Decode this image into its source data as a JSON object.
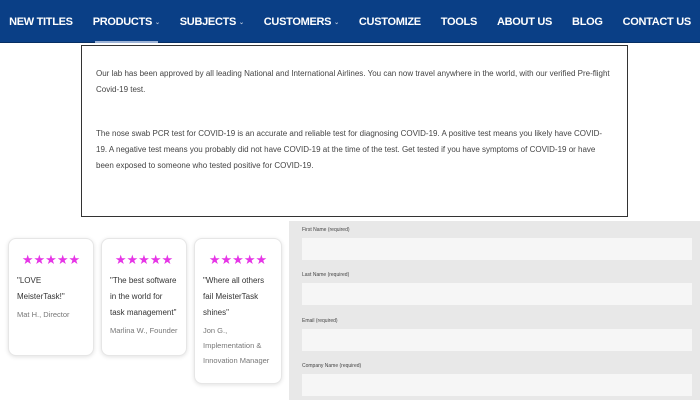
{
  "nav": {
    "items": [
      {
        "label": "NEW TITLES",
        "has_dropdown": false
      },
      {
        "label": "PRODUCTS",
        "has_dropdown": true
      },
      {
        "label": "SUBJECTS",
        "has_dropdown": true
      },
      {
        "label": "CUSTOMERS",
        "has_dropdown": true
      },
      {
        "label": "CUSTOMIZE",
        "has_dropdown": false
      },
      {
        "label": "TOOLS",
        "has_dropdown": false
      },
      {
        "label": "ABOUT US",
        "has_dropdown": false
      },
      {
        "label": "BLOG",
        "has_dropdown": false
      },
      {
        "label": "CONTACT US",
        "has_dropdown": false
      }
    ],
    "dropdown_glyph": "⌄",
    "active_index": 1,
    "background": "#0a3f86"
  },
  "content": {
    "paragraph1": "Our lab has been approved by all leading National and International Airlines. You can now travel anywhere in the world, with our verified Pre-flight Covid-19 test.",
    "paragraph2": "The nose swab PCR test for COVID-19 is an accurate and reliable test for diagnosing COVID-19. A positive test means you likely have COVID-19. A negative test means you probably did not have COVID-19 at the time of the test. Get tested if you have symptoms of COVID-19 or have been exposed to someone who tested positive for COVID-19."
  },
  "testimonials": [
    {
      "stars": "★★★★★",
      "rating": 5,
      "quote": "\"LOVE MeisterTask!\"",
      "author": "Mat H., Director"
    },
    {
      "stars": "★★★★★",
      "rating": 5,
      "quote": "\"The best software in the world for task management\"",
      "author": "Marlina W., Founder"
    },
    {
      "stars": "★★★★★",
      "rating": 5,
      "quote": "\"Where all others fail MeisterTask shines\"",
      "author": "Jon G., Implementation & Innovation Manager"
    }
  ],
  "star_color": "#e635e6",
  "form": {
    "fields": [
      {
        "label": "First Name (required)",
        "value": ""
      },
      {
        "label": "Last Name (required)",
        "value": ""
      },
      {
        "label": "Email (required)",
        "value": ""
      },
      {
        "label": "Company Name (required)",
        "value": ""
      }
    ]
  }
}
